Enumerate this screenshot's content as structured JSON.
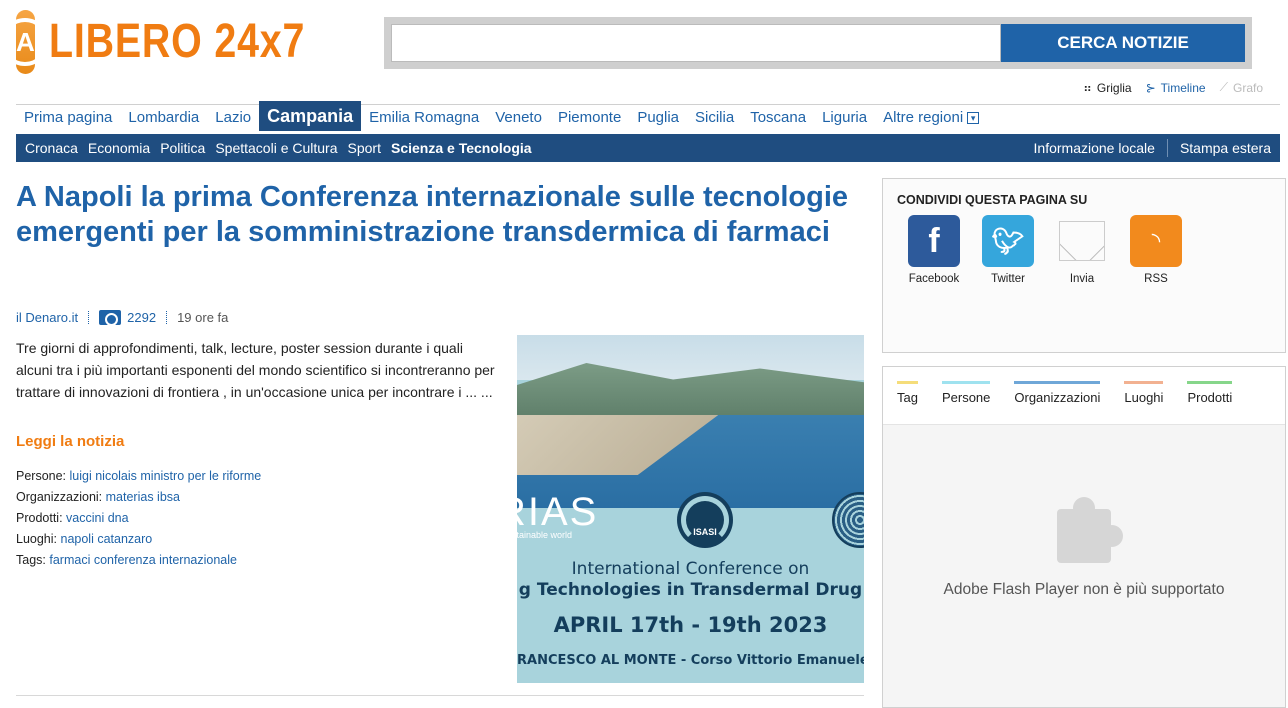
{
  "header": {
    "logo_text": "LIBERO 24x7",
    "search_value": "",
    "search_button": "CERCA NOTIZIE"
  },
  "views": [
    {
      "label": "Griglia",
      "state": "active"
    },
    {
      "label": "Timeline",
      "state": "link"
    },
    {
      "label": "Grafo",
      "state": "disabled"
    }
  ],
  "nav_regions": [
    "Prima pagina",
    "Lombardia",
    "Lazio",
    "Campania",
    "Emilia Romagna",
    "Veneto",
    "Piemonte",
    "Puglia",
    "Sicilia",
    "Toscana",
    "Liguria",
    "Altre regioni"
  ],
  "nav_regions_active": "Campania",
  "nav_categories": [
    "Cronaca",
    "Economia",
    "Politica",
    "Spettacoli e Cultura",
    "Sport",
    "Scienza e Tecnologia"
  ],
  "nav_categories_active": "Scienza e Tecnologia",
  "nav_right": [
    "Informazione locale",
    "Stampa estera"
  ],
  "article": {
    "title": "A Napoli la prima Conferenza internazionale sulle tecnologie emergenti per la somministrazione transdermica di farmaci",
    "source": "il Denaro.it",
    "photo_count": "2292",
    "time": "19 ore fa",
    "lead": "Tre giorni di approfondimenti, talk, lecture, poster session durante i quali alcuni tra i più importanti esponenti del mondo scientifico si incontreranno per trattare di  innovazioni di frontiera , in un'occasione unica per incontrare i ... ...",
    "read_more": "Leggi la notizia",
    "tags": [
      {
        "label": "Persone:",
        "value": "luigi nicolais ministro per le riforme"
      },
      {
        "label": "Organizzazioni:",
        "value": "materias ibsa"
      },
      {
        "label": "Prodotti:",
        "value": "vaccini dna"
      },
      {
        "label": "Luoghi:",
        "value": "napoli catanzaro"
      },
      {
        "label": "Tags:",
        "value": "farmaci conferenza internazionale"
      }
    ]
  },
  "image": {
    "logo_left": "RIAS",
    "logo_left_sub": "ustainable world",
    "logo_center": "ISASI",
    "line1": "International Conference on",
    "line2": "g Technologies in Transdermal Drug",
    "dates": "APRIL 17th - 19th 2023",
    "venue": "RANCESCO AL MONTE - Corso Vittorio Emanuele"
  },
  "share": {
    "title": "CONDIVIDI QUESTA PAGINA SU",
    "items": [
      {
        "label": "Facebook",
        "icon": "facebook-icon"
      },
      {
        "label": "Twitter",
        "icon": "twitter-icon"
      },
      {
        "label": "Invia",
        "icon": "mail-icon"
      },
      {
        "label": "RSS",
        "icon": "rss-icon"
      }
    ]
  },
  "tagbox": {
    "tabs": [
      {
        "label": "Tag",
        "color": "#f5dd7a"
      },
      {
        "label": "Persone",
        "color": "#9fe2ef"
      },
      {
        "label": "Organizzazioni",
        "color": "#6fa7d8"
      },
      {
        "label": "Luoghi",
        "color": "#f2b191"
      },
      {
        "label": "Prodotti",
        "color": "#86d68a"
      }
    ],
    "flash_message": "Adobe Flash Player non è più supportato"
  },
  "colors": {
    "brand_orange": "#f07c12",
    "brand_blue": "#1f63a8",
    "nav_dark": "#1f4d80"
  }
}
